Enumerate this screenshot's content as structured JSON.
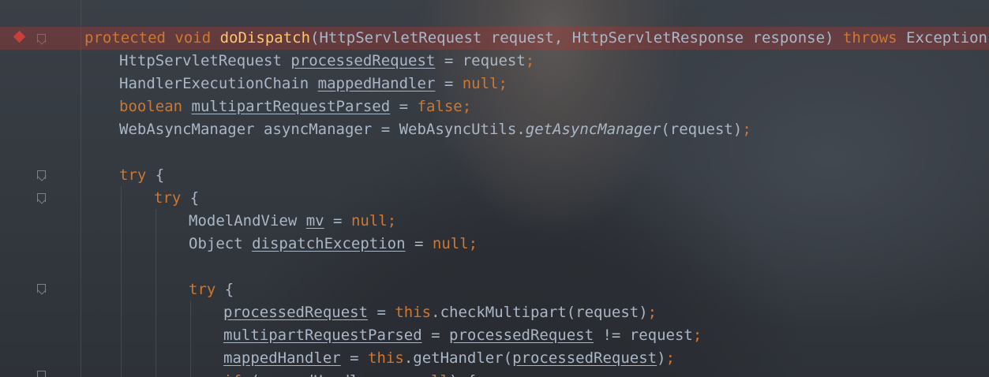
{
  "editor": {
    "code_lines": [
      [
        "protected",
        " ",
        "void",
        " ",
        "doDispatch",
        "(HttpServletRequest request, HttpServletResponse response) ",
        "throws",
        " Exception {"
      ],
      [
        "HttpServletRequest ",
        "processedRequest",
        " = request",
        ";"
      ],
      [
        "HandlerExecutionChain ",
        "mappedHandler",
        " = ",
        "null",
        ";"
      ],
      [
        "boolean",
        " ",
        "multipartRequestParsed",
        " = ",
        "false",
        ";"
      ],
      [
        "WebAsyncManager asyncManager = WebAsyncUtils.",
        "getAsyncManager",
        "(request)",
        ";"
      ],
      [],
      [
        "try",
        " {"
      ],
      [
        "try",
        " {"
      ],
      [
        "ModelAndView ",
        "mv",
        " = ",
        "null",
        ";"
      ],
      [
        "Object ",
        "dispatchException",
        " = ",
        "null",
        ";"
      ],
      [],
      [
        "try",
        " {"
      ],
      [
        "processedRequest",
        " = ",
        "this",
        ".checkMultipart(request)",
        ";"
      ],
      [
        "multipartRequestParsed",
        " = ",
        "processedRequest",
        " != request",
        ";"
      ],
      [
        "mappedHandler",
        " = ",
        "this",
        ".getHandler(",
        "processedRequest",
        ")",
        ";"
      ],
      [
        "if",
        " (",
        "mappedHandler",
        " == ",
        "null",
        ") {"
      ]
    ],
    "colors": {
      "keyword": "#cc7832",
      "function": "#ffc66d",
      "text": "#a9b7c6",
      "breakpoint": "#d8463f",
      "breakpoint_line": "#6a3430"
    },
    "gutter_icons": [
      "breakpoint-icon",
      "fold-icon"
    ]
  }
}
